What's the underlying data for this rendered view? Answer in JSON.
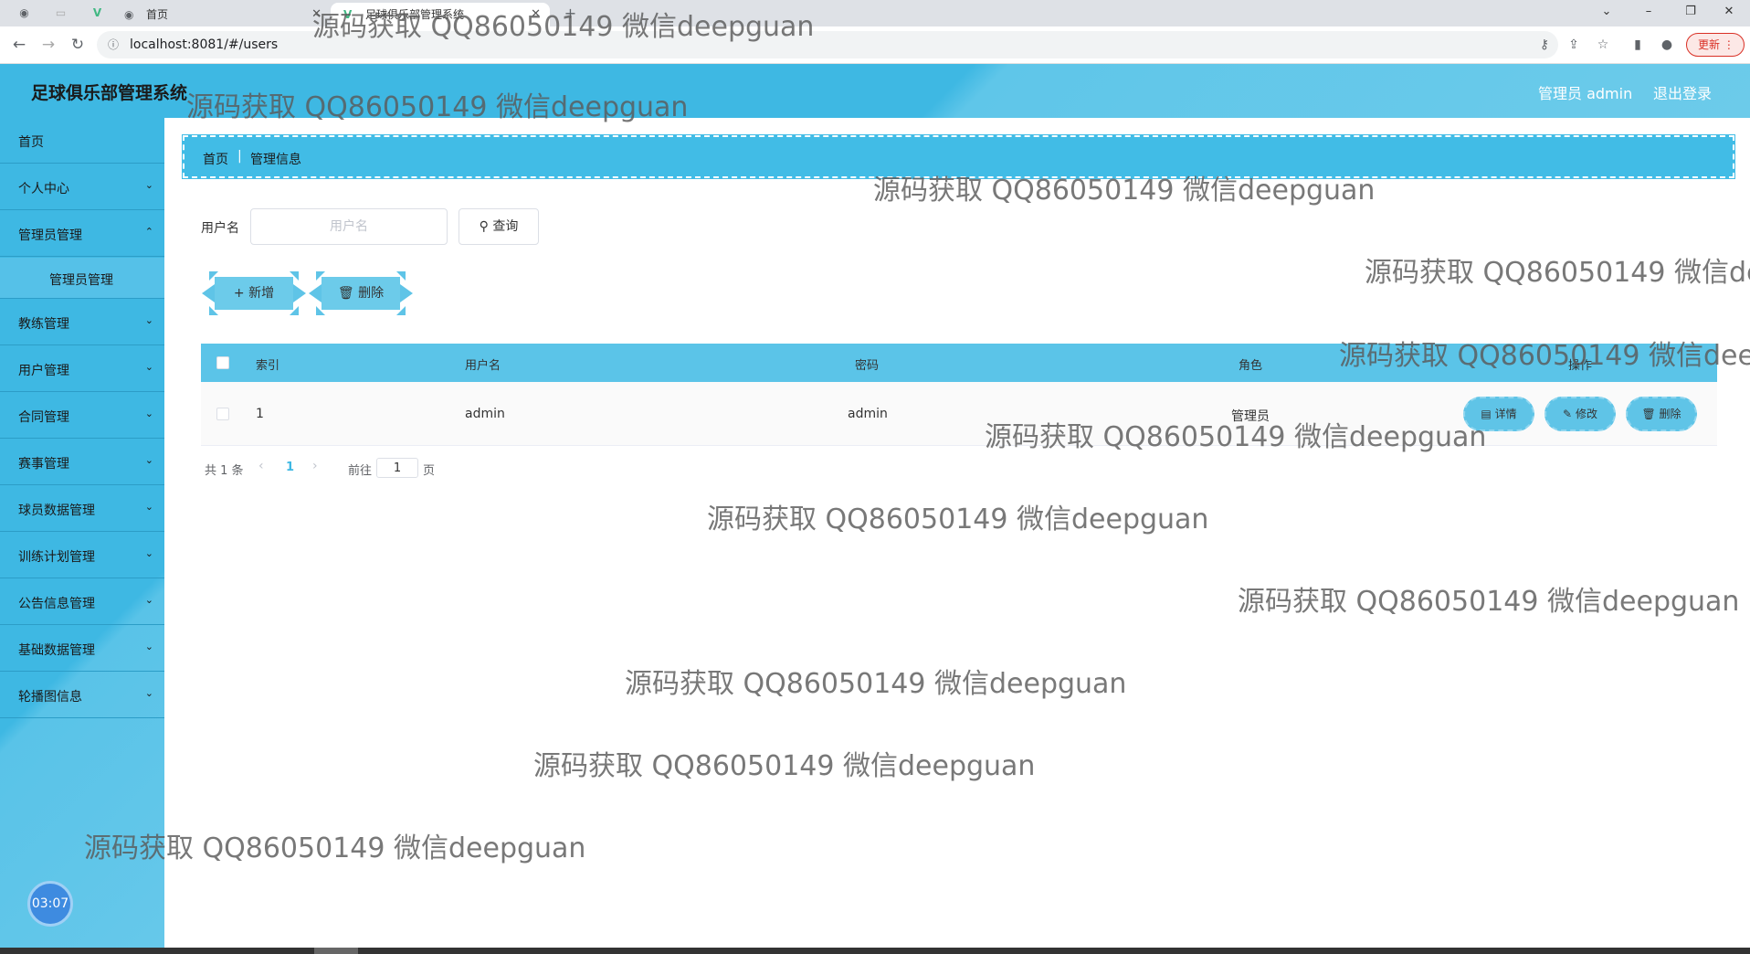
{
  "browser": {
    "tabs": [
      {
        "label": "首页"
      },
      {
        "label": "足球俱乐部管理系统"
      }
    ],
    "url": "localhost:8081/#/users",
    "update_label": "更新 ⋮"
  },
  "header": {
    "title": "足球俱乐部管理系统",
    "user": "管理员 admin",
    "logout": "退出登录"
  },
  "sidebar": {
    "items": [
      {
        "label": "首页"
      },
      {
        "label": "个人中心"
      },
      {
        "label": "管理员管理"
      },
      {
        "label": "管理员管理"
      },
      {
        "label": "教练管理"
      },
      {
        "label": "用户管理"
      },
      {
        "label": "合同管理"
      },
      {
        "label": "赛事管理"
      },
      {
        "label": "球员数据管理"
      },
      {
        "label": "训练计划管理"
      },
      {
        "label": "公告信息管理"
      },
      {
        "label": "基础数据管理"
      },
      {
        "label": "轮播图信息"
      }
    ],
    "clock": "03:07"
  },
  "breadcrumb": {
    "home": "首页",
    "separator": "|",
    "current": "管理信息"
  },
  "search": {
    "label": "用户名",
    "placeholder": "用户名",
    "value": "",
    "button": "查询"
  },
  "actions": {
    "add": "新增",
    "delete": "删除"
  },
  "table": {
    "columns": [
      "索引",
      "用户名",
      "密码",
      "角色",
      "操作"
    ],
    "rows": [
      {
        "index": "1",
        "username": "admin",
        "password": "admin",
        "role": "管理员"
      }
    ],
    "row_actions": {
      "detail": "详情",
      "edit": "修改",
      "delete": "删除"
    }
  },
  "pagination": {
    "total": "共 1 条",
    "current": "1",
    "goto": "前往",
    "page_value": "1",
    "page_unit": "页"
  },
  "watermark": "源码获取 QQ86050149 微信deepguan",
  "colors": {
    "primary": "#3eb8e3",
    "header_light": "#6ccbea"
  }
}
